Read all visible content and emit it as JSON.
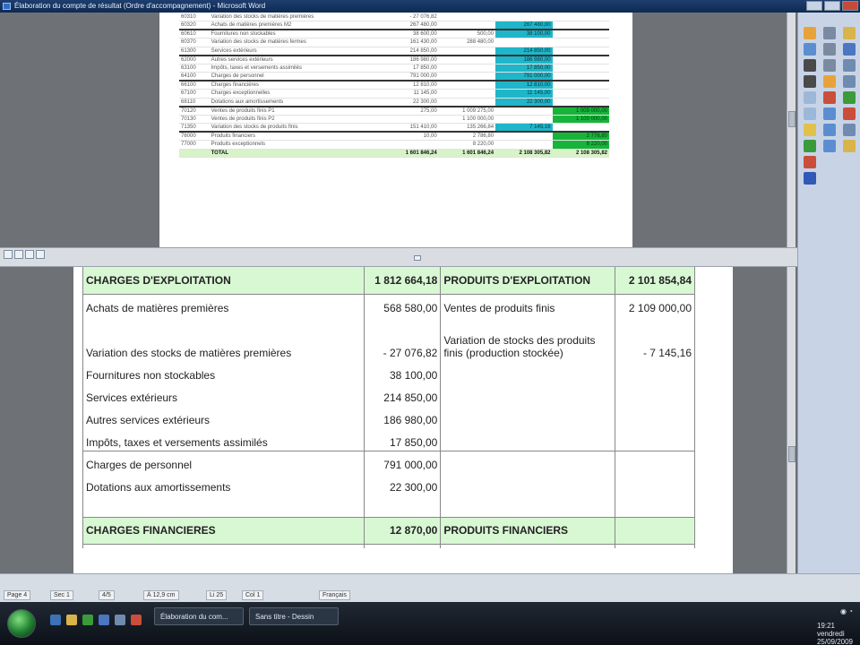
{
  "window": {
    "title": "Élaboration du compte de résultat (Ordre d'accompagnement) - Microsoft Word"
  },
  "mini_table": {
    "rows": [
      {
        "code": "60310",
        "label": "Variation des stocks de matières premières",
        "c1": "- 27 076,82",
        "c2": "",
        "c3": "",
        "c4": "",
        "cls": ""
      },
      {
        "code": "60320",
        "label": "Achats de matières premières M2",
        "c1": "267 480,00",
        "c2": "",
        "c3": "267 480,00",
        "c4": "",
        "cls": ""
      },
      {
        "code": "60610",
        "label": "Fournitures non stockables",
        "c1": "38 600,00",
        "c2": "500,00",
        "c3": "38 100,00",
        "c4": "",
        "cls": "sep"
      },
      {
        "code": "60370",
        "label": "Variation des stocks de matières fermes",
        "c1": "161 430,00",
        "c2": "288 480,00",
        "c3": "",
        "c4": "",
        "cls": ""
      },
      {
        "code": "61300",
        "label": "Services extérieurs",
        "c1": "214 850,00",
        "c2": "",
        "c3": "214 850,00",
        "c4": "",
        "cls": ""
      },
      {
        "code": "62000",
        "label": "Autres services extérieurs",
        "c1": "186 980,00",
        "c2": "",
        "c3": "186 980,00",
        "c4": "",
        "cls": "sep"
      },
      {
        "code": "63100",
        "label": "Impôts, taxes et versements assimilés",
        "c1": "17 850,00",
        "c2": "",
        "c3": "17 850,00",
        "c4": "",
        "cls": ""
      },
      {
        "code": "64100",
        "label": "Charges de personnel",
        "c1": "791 000,00",
        "c2": "",
        "c3": "791 000,00",
        "c4": "",
        "cls": ""
      },
      {
        "code": "66100",
        "label": "Charges financières",
        "c1": "12 810,00",
        "c2": "",
        "c3": "12 810,00",
        "c4": "",
        "cls": "sep"
      },
      {
        "code": "67100",
        "label": "Charges exceptionnelles",
        "c1": "11 145,00",
        "c2": "",
        "c3": "11 145,00",
        "c4": "",
        "cls": ""
      },
      {
        "code": "68110",
        "label": "Dotations aux amortissements",
        "c1": "22 300,00",
        "c2": "",
        "c3": "22 300,00",
        "c4": "",
        "cls": ""
      },
      {
        "code": "70120",
        "label": "Ventes de produits finis P1",
        "c1": "275,00",
        "c2": "1 009 275,00",
        "c3": "",
        "c4": "1 009 000,00",
        "cls": "sep"
      },
      {
        "code": "70130",
        "label": "Ventes de produits finis P2",
        "c1": "",
        "c2": "1 100 000,00",
        "c3": "",
        "c4": "1 100 000,00",
        "cls": ""
      },
      {
        "code": "71350",
        "label": "Variation des stocks de produits finis",
        "c1": "151 410,00",
        "c2": "135 266,84",
        "c3": "7 145,16",
        "c4": "",
        "cls": ""
      },
      {
        "code": "76000",
        "label": "Produits financiers",
        "c1": "10,00",
        "c2": "2 786,80",
        "c3": "",
        "c4": "2 776,80",
        "cls": "sep"
      },
      {
        "code": "77000",
        "label": "Produits exceptionnels",
        "c1": "",
        "c2": "8 220,00",
        "c3": "",
        "c4": "8 220,00",
        "cls": ""
      },
      {
        "code": "",
        "label": "TOTAL",
        "c1": "1 601 846,24",
        "c2": "1 601 846,24",
        "c3": "2 108 305,82",
        "c4": "2 108 305,82",
        "cls": "total"
      }
    ]
  },
  "compte_resultat": {
    "charges_exploitation": {
      "label": "CHARGES D'EXPLOITATION",
      "amount": "1 812 664,18"
    },
    "produits_exploitation": {
      "label": "PRODUITS D'EXPLOITATION",
      "amount": "2 101 854,84"
    },
    "rows": [
      {
        "label": "Achats de matières premières",
        "amount": "568 580,00",
        "p_label": "Ventes de produits finis",
        "p_amount": "2 109 000,00"
      },
      {
        "label": "Variation des stocks de matières premières",
        "amount": "- 27 076,82",
        "p_label": "Variation de stocks des produits finis (production stockée)",
        "p_amount": "- 7 145,16"
      },
      {
        "label": "Fournitures non stockables",
        "amount": "38 100,00",
        "p_label": "",
        "p_amount": ""
      },
      {
        "label": "Services extérieurs",
        "amount": "214 850,00",
        "p_label": "",
        "p_amount": ""
      },
      {
        "label": "Autres services extérieurs",
        "amount": "186 980,00",
        "p_label": "",
        "p_amount": ""
      },
      {
        "label": "Impôts, taxes et versements assimilés",
        "amount": "17 850,00",
        "p_label": "",
        "p_amount": ""
      },
      {
        "label": "Charges de personnel",
        "amount": "791 000,00",
        "p_label": "",
        "p_amount": ""
      },
      {
        "label": "Dotations aux amortissements",
        "amount": "22 300,00",
        "p_label": "",
        "p_amount": ""
      }
    ],
    "charges_financieres": {
      "label": "CHARGES FINANCIERES",
      "amount": "12 870,00"
    },
    "produits_financiers": {
      "label": "PRODUITS FINANCIERS",
      "amount": ""
    }
  },
  "statusbar": {
    "page": "Page 4",
    "section": "Sec 1",
    "pages": "4/5",
    "position": "À 12,9 cm",
    "line": "Li 25",
    "col": "Col 1",
    "lang": "Français"
  },
  "taskbar": {
    "tasks": [
      "Élaboration du com...",
      "Sans titre - Dessin"
    ],
    "clock_time": "19:21",
    "clock_day": "vendredi",
    "clock_date": "25/09/2009"
  },
  "colors": {
    "header_green": "#d8f7d3",
    "cyan_highlight": "#1fb6c9",
    "green_highlight": "#16b53a"
  }
}
